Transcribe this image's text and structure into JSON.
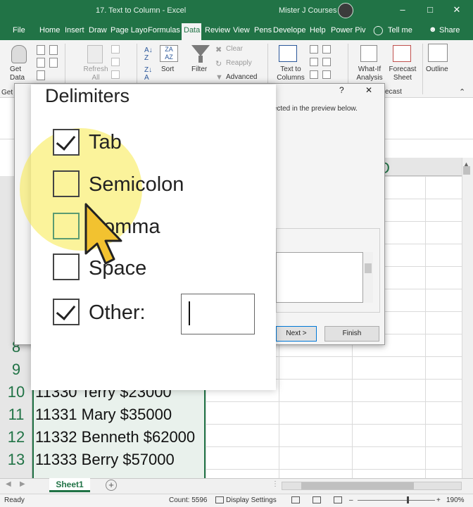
{
  "window": {
    "title": "17. Text to Column  -  Excel",
    "user": "Mister J Courses",
    "minimize_glyph": "–",
    "restore_glyph": "□",
    "close_glyph": "✕"
  },
  "ribbon_tabs": [
    "File",
    "Home",
    "Insert",
    "Draw",
    "Page Layo",
    "Formulas",
    "Data",
    "Review",
    "View",
    "Pens",
    "Develope",
    "Help",
    "Power Piv",
    "Tell me",
    "Share"
  ],
  "active_tab": "Data",
  "ribbon": {
    "get_data": "Get Data",
    "refresh_all": "Refresh All",
    "sort": "Sort",
    "filter": "Filter",
    "clear": "Clear",
    "reapply": "Reapply",
    "advanced": "Advanced",
    "text_to_columns": "Text to Columns",
    "what_if": "What-If Analysis",
    "forecast_sheet": "Forecast Sheet",
    "outline": "Outline",
    "group_get": "Get",
    "group_forecast": "ecast"
  },
  "sheet": {
    "column_header": "D",
    "rows": [
      {
        "num": "8",
        "text": ""
      },
      {
        "num": "9",
        "text": ""
      },
      {
        "num": "10",
        "text": "11330 Terry $23000"
      },
      {
        "num": "11",
        "text": "11331 Mary $35000"
      },
      {
        "num": "12",
        "text": "11332 Benneth $62000"
      },
      {
        "num": "13",
        "text": "11333 Berry $57000"
      }
    ],
    "tab_name": "Sheet1",
    "add_sheet": "+"
  },
  "status": {
    "ready": "Ready",
    "count": "Count: 5596",
    "display_settings": "Display Settings",
    "zoom": "190%"
  },
  "dialog": {
    "help_glyph": "?",
    "close_glyph": "✕",
    "preview_text": "fected in the preview below.",
    "next": "Next >",
    "finish": "Finish"
  },
  "delimiters": {
    "title": "Delimiters",
    "options": [
      {
        "label": "Tab",
        "checked": true
      },
      {
        "label": "Semicolon",
        "checked": false
      },
      {
        "label": "Comma",
        "checked": false
      },
      {
        "label": "Space",
        "checked": false
      },
      {
        "label": "Other:",
        "checked": true
      }
    ],
    "other_value": ""
  }
}
